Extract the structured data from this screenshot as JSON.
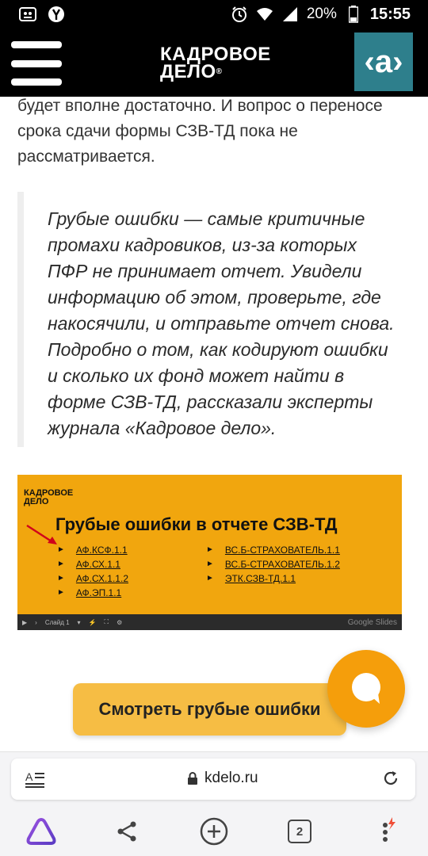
{
  "status_bar": {
    "battery": "20%",
    "time": "15:55"
  },
  "header": {
    "logo_line1": "КАДРОВОЕ",
    "logo_line2": "ДЕЛО",
    "badge": "‹a›"
  },
  "article": {
    "intro": "будет вполне достаточно. И вопрос о переносе срока сдачи формы СЗВ-ТД пока не рассматривается.",
    "quote": "Грубые ошибки — самые критичные промахи кадровиков, из-за которых ПФР не принимает отчет. Увидели информацию об этом, проверьте, где накосячили, и отправьте отчет снова. Подробно о том, как кодируют ошибки и сколько их фонд может найти в форме СЗВ-ТД, рассказали эксперты журнала «Кадровое дело»."
  },
  "slide": {
    "logo_line1": "КАДРОВОЕ",
    "logo_line2": "ДЕЛО",
    "title": "Грубые ошибки в отчете СЗВ-ТД",
    "col1": [
      "АФ.КСФ.1.1",
      "АФ.СХ.1.1",
      "АФ.СХ.1.1.2",
      "АФ.ЭП.1.1"
    ],
    "col2": [
      "ВС.Б-СТРАХОВАТЕЛЬ.1.1",
      "ВС.Б-СТРАХОВАТЕЛЬ.1.2",
      "ЭТК.СЗВ-ТД.1.1"
    ],
    "controls_slide": "Слайд 1",
    "controls_brand": "Google Slides"
  },
  "cta": {
    "label": "Смотреть грубые ошибки"
  },
  "browser": {
    "url": "kdelo.ru",
    "tab_count": "2"
  },
  "colors": {
    "header_bg": "#000000",
    "badge_bg": "#2e7f8c",
    "slide_bg": "#f1a60e",
    "cta_bg": "#f6bd44",
    "fab_bg": "#f59e0b"
  }
}
